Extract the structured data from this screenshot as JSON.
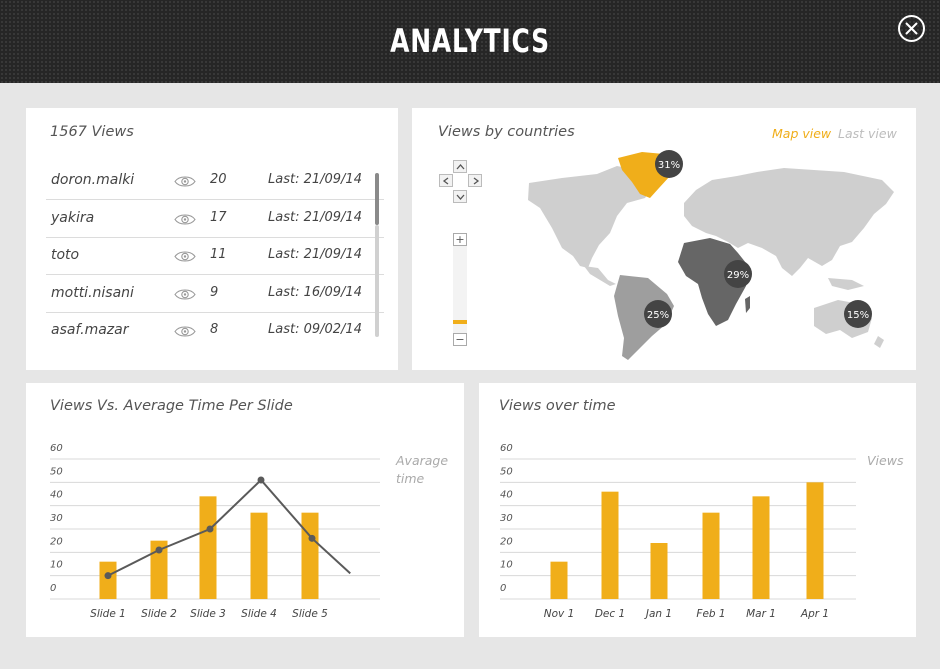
{
  "header": {
    "title": "ANALYTICS"
  },
  "views": {
    "title": "1567 Views",
    "rows": [
      {
        "name": "doron.malki",
        "count": "20",
        "last": "Last: 21/09/14"
      },
      {
        "name": "yakira",
        "count": "17",
        "last": "Last: 21/09/14"
      },
      {
        "name": "toto",
        "count": "11",
        "last": "Last: 21/09/14"
      },
      {
        "name": "motti.nisani",
        "count": "9",
        "last": "Last: 16/09/14"
      },
      {
        "name": "asaf.mazar",
        "count": "8",
        "last": "Last: 09/02/14"
      }
    ]
  },
  "map": {
    "title": "Views by countries",
    "tabs": {
      "map_view": "Map view",
      "last_view": "Last view"
    },
    "zoom": {
      "plus": "+",
      "minus": "−",
      "level": 0.1
    },
    "badges": {
      "greenland": "31%",
      "africa": "29%",
      "south_america": "25%",
      "australia": "15%"
    }
  },
  "chart1": {
    "title": "Views Vs. Average Time Per Slide",
    "legend": [
      "Avarage",
      "time"
    ]
  },
  "chart2": {
    "title": "Views over time",
    "legend": "Views"
  },
  "colors": {
    "accent": "#f0ae1a",
    "line": "#5a5a5a",
    "map_land": "#cfcfcf",
    "map_highlight": "#f0ae1a"
  },
  "chart_data": [
    {
      "type": "bar",
      "title": "Views Vs. Average Time Per Slide",
      "categories": [
        "Slide 1",
        "Slide 2",
        "Slide 3",
        "Slide 4",
        "Slide 5"
      ],
      "series": [
        {
          "name": "",
          "type": "bar",
          "values": [
            16,
            25,
            44,
            37,
            37
          ]
        },
        {
          "name": "Avarage time",
          "type": "line",
          "x": [
            1,
            2,
            3,
            4,
            5,
            5.75
          ],
          "values": [
            10,
            21,
            30,
            51,
            26,
            11
          ]
        }
      ],
      "yticks": [
        "0",
        "10",
        "20",
        "30",
        "40",
        "50",
        "60"
      ],
      "ylim": [
        0,
        60
      ],
      "grid": true,
      "legend_position": "right"
    },
    {
      "type": "bar",
      "title": "Views over time",
      "categories": [
        "Nov 1",
        "Dec 1",
        "Jan 1",
        "Feb 1",
        "Mar 1",
        "Apr 1"
      ],
      "series": [
        {
          "name": "Views",
          "values": [
            16,
            46,
            24,
            37,
            44,
            50
          ]
        }
      ],
      "yticks": [
        "0",
        "10",
        "20",
        "30",
        "40",
        "50",
        "60"
      ],
      "ylim": [
        0,
        60
      ],
      "grid": true,
      "legend_position": "right"
    }
  ]
}
